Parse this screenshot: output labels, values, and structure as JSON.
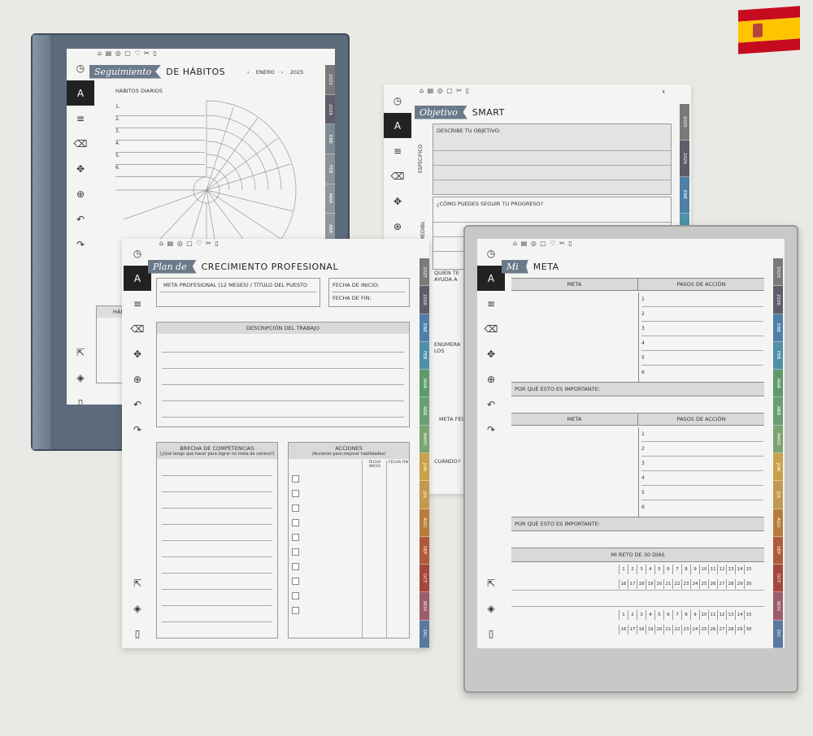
{
  "flag": {
    "red": "#c60b1e",
    "yellow": "#ffc400",
    "icon": "spain-flag-icon"
  },
  "colors": {
    "tab_2025": "#7a7a7a",
    "tab_2026": "#5d5d6b",
    "tab_months": [
      "#4f7fa6",
      "#4f8fa8",
      "#5e9a6a",
      "#6a9e74",
      "#7aa36e",
      "#c9a14a",
      "#c29a4e",
      "#b77c3c",
      "#b05a3a",
      "#a5473c",
      "#9a5d6b",
      "#5879a0"
    ]
  },
  "tabs": [
    "2025",
    "2026",
    "ENE",
    "FEB",
    "MAR",
    "ABR",
    "MAYO",
    "JUN",
    "JUL",
    "AGO",
    "SEP",
    "OCT",
    "NOV",
    "DIC"
  ],
  "habits": {
    "script": "Seguimiento",
    "title": "DE HÁBITOS",
    "month": "ENERO",
    "year": "2025",
    "subtitle": "HÁBITOS DIARIOS",
    "numbers": [
      "1.",
      "2.",
      "3.",
      "4.",
      "5.",
      "6."
    ],
    "bottom_label": "HÁBI"
  },
  "smart": {
    "script": "Objetivo",
    "title": "SMART",
    "q1": "DESCRIBE TU OBJETIVO:",
    "side1": "ESPECÍFICO",
    "q2": "¿CÓMO PUEDES SEGUIR TU PROGRESO?",
    "side2": "MEDIBL",
    "q3": "QUIÉN TE AYUDA A ALCANZAR TU OBJETIVO",
    "q4": "ENUMERA LOS RECURSOS PARA TU OBJETIVO",
    "q5": "META FEC",
    "q6": "CUÁNDO?"
  },
  "career": {
    "script": "Plan de",
    "title": "CRECIMIENTO PROFESIONAL",
    "goal": "META PROFESIONAL (12 MESES) / TÍTULO DEL PUESTO",
    "start": "FECHA DE INICIO:",
    "end": "FECHA DE FIN:",
    "desc": "DESCRIPCIÓN DEL TRABAJO",
    "gap": "BRECHA DE COMPETENCIAS",
    "gap_sub": "(¿Qué tengo que hacer para lograr mi meta de carrera?)",
    "actions": "ACCIONES",
    "actions_sub": "(Acciones para mejorar habilidades)",
    "col1": "FECHA INICIO",
    "col2": "FECHA FIN"
  },
  "meta": {
    "script": "Mi",
    "title": "META",
    "col_meta": "META",
    "col_steps": "PASOS DE ACCIÓN",
    "why": "POR QUÉ ESTO ES IMPORTANTE:",
    "steps": [
      "1",
      "2",
      "3",
      "4",
      "5",
      "6"
    ],
    "challenge": "MI RETO DE 30 DÍAS",
    "days1": [
      "1",
      "2",
      "3",
      "4",
      "5",
      "6",
      "7",
      "8",
      "9",
      "10",
      "11",
      "12",
      "13",
      "14",
      "15"
    ],
    "days2": [
      "16",
      "17",
      "18",
      "19",
      "20",
      "21",
      "22",
      "23",
      "24",
      "25",
      "26",
      "27",
      "28",
      "29",
      "30"
    ]
  }
}
